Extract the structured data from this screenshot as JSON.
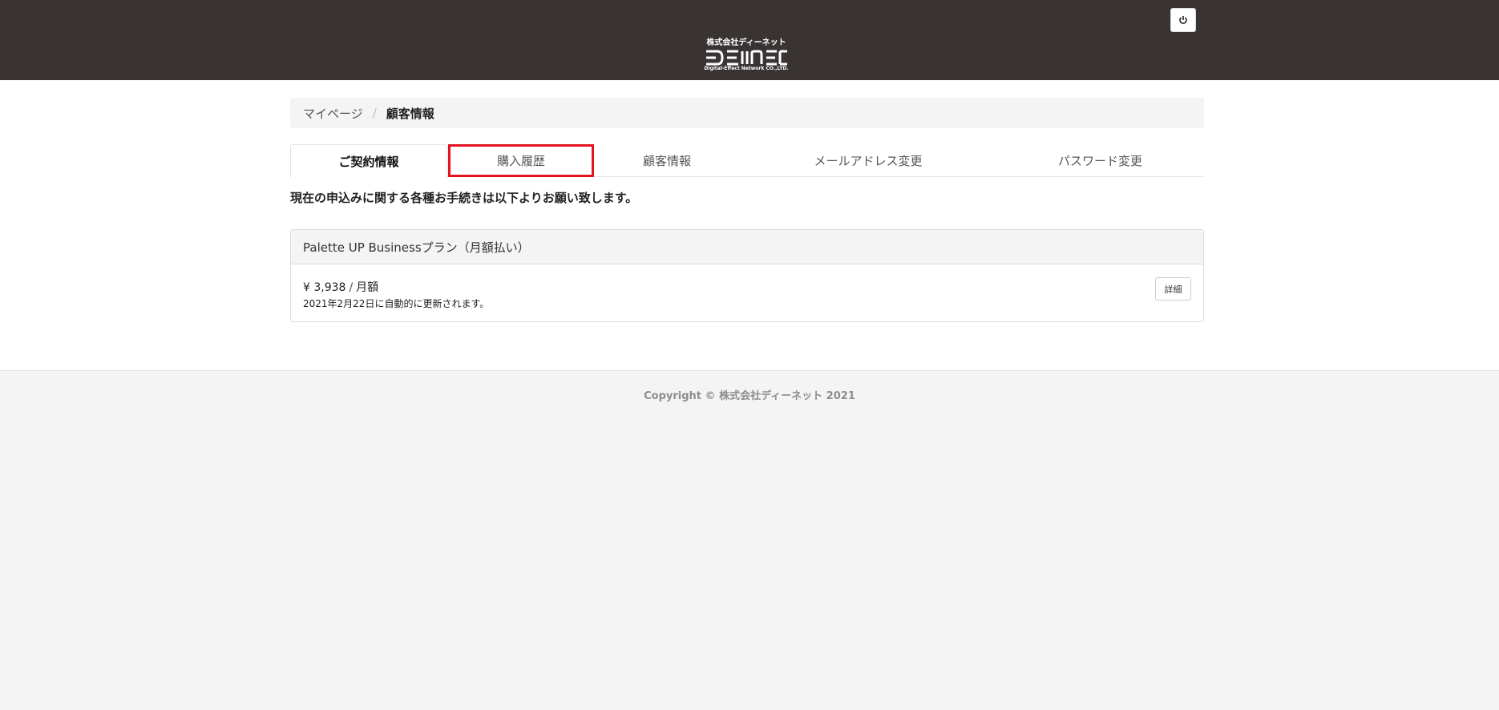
{
  "header": {
    "logo_company": "株式会社ディーネット",
    "logo_mark": "DEINET",
    "logo_sub": "Digital-Effect Network CO.,LTD.",
    "power_icon": "power-icon"
  },
  "breadcrumb": {
    "home": "マイページ",
    "separator": "/",
    "current": "顧客情報"
  },
  "tabs": [
    {
      "label": "ご契約情報"
    },
    {
      "label": "購入履歴"
    },
    {
      "label": "顧客情報"
    },
    {
      "label": "メールアドレス変更"
    },
    {
      "label": "パスワード変更"
    }
  ],
  "intro_text": "現在の申込みに関する各種お手続きは以下よりお願い致します。",
  "plan": {
    "name": "Palette UP Businessプラン（月額払い）",
    "price": "¥ 3,938",
    "price_separator": "/",
    "price_period": "月額",
    "renewal_text": "2021年2月22日に自動的に更新されます。",
    "detail_label": "詳細"
  },
  "footer": {
    "copyright": "Copyright © 株式会社ディーネット 2021"
  },
  "colors": {
    "header_bg": "#393433",
    "highlight": "#e1141f"
  }
}
